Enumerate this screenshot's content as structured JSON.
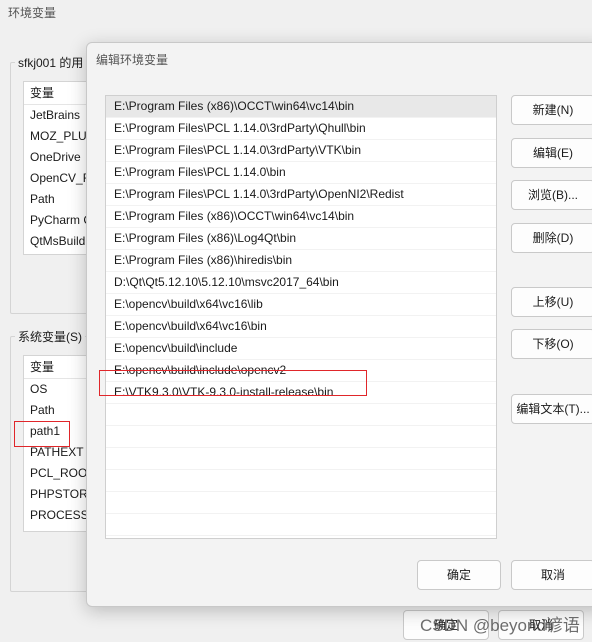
{
  "back_window": {
    "title": "环境变量",
    "user_group_label": "sfkj001 的用",
    "user_vars": {
      "header": "变量",
      "rows": [
        "JetBrains",
        "MOZ_PLU",
        "OneDrive",
        "OpenCV_F",
        "Path",
        "PyCharm C",
        "QtMsBuild"
      ]
    },
    "system_group_label": "系统变量(S)",
    "system_vars": {
      "header": "变量",
      "rows": [
        "OS",
        "Path",
        "path1",
        "PATHEXT",
        "PCL_ROOT",
        "PHPSTOR",
        "PROCESSO"
      ]
    },
    "bottom_ok": "确定",
    "bottom_cancel": "取消"
  },
  "dialog": {
    "title": "编辑环境变量",
    "paths": [
      "E:\\Program Files (x86)\\OCCT\\win64\\vc14\\bin",
      "E:\\Program Files\\PCL 1.14.0\\3rdParty\\Qhull\\bin",
      "E:\\Program Files\\PCL 1.14.0\\3rdParty\\VTK\\bin",
      "E:\\Program Files\\PCL 1.14.0\\bin",
      "E:\\Program Files\\PCL 1.14.0\\3rdParty\\OpenNI2\\Redist",
      "E:\\Program Files (x86)\\OCCT\\win64\\vc14\\bin",
      "E:\\Program Files (x86)\\Log4Qt\\bin",
      "E:\\Program Files (x86)\\hiredis\\bin",
      "D:\\Qt\\Qt5.12.10\\5.12.10\\msvc2017_64\\bin",
      "E:\\opencv\\build\\x64\\vc16\\lib",
      "E:\\opencv\\build\\x64\\vc16\\bin",
      "E:\\opencv\\build\\include",
      "E:\\opencv\\build\\include\\opencv2",
      "E:\\VTK9.3.0\\VTK-9.3.0-install-release\\bin"
    ],
    "buttons": {
      "new": "新建(N)",
      "edit": "编辑(E)",
      "browse": "浏览(B)...",
      "delete": "删除(D)",
      "move_up": "上移(U)",
      "move_down": "下移(O)",
      "edit_text": "编辑文本(T)...",
      "ok": "确定",
      "cancel": "取消"
    }
  },
  "watermark": "CSDN @beyond谚语",
  "colors": {
    "highlight_box": "#e0262a"
  }
}
